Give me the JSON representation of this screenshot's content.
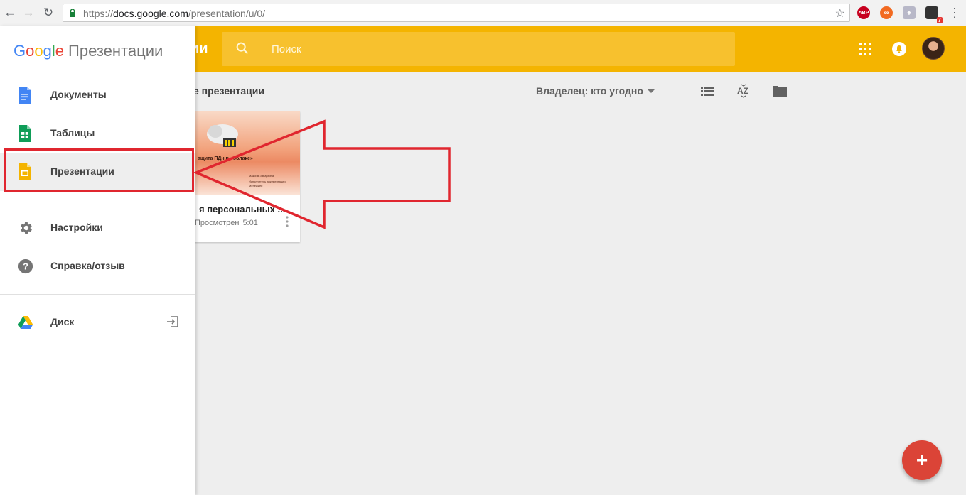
{
  "browser": {
    "url_prefix": "https://",
    "url_host": "docs.google.com",
    "url_path": "/presentation/u/0/",
    "extensions": [
      {
        "icon": "adblock-icon",
        "label": "ABP",
        "color": "#c7001f"
      },
      {
        "icon": "infinity-extension-icon",
        "color": "#f26a21"
      },
      {
        "icon": "bookmark-extension-icon",
        "color": "#a8a8b8"
      },
      {
        "icon": "notification-extension-icon",
        "badge": "7",
        "color": "#333333"
      }
    ]
  },
  "header": {
    "title_partial": "ии",
    "search_placeholder": "Поиск",
    "accent": "#f4b400"
  },
  "drawer": {
    "brand_letters": [
      "G",
      "o",
      "o",
      "g",
      "l",
      "e"
    ],
    "product_name": "Презентации",
    "items": [
      {
        "label": "Документы",
        "icon": "docs-icon",
        "color": "#4285f4"
      },
      {
        "label": "Таблицы",
        "icon": "sheets-icon",
        "color": "#0f9d58"
      },
      {
        "label": "Презентации",
        "icon": "slides-icon",
        "color": "#f4b400",
        "active": true
      },
      {
        "label": "Настройки",
        "icon": "gear-icon"
      },
      {
        "label": "Справка/отзыв",
        "icon": "help-icon"
      },
      {
        "label": "Диск",
        "icon": "drive-icon"
      }
    ]
  },
  "main": {
    "section_title": "е презентации",
    "owner_filter": "Владелец: кто угодно",
    "files": [
      {
        "title": "я персональных ...",
        "meta_label": "Просмотрен",
        "meta_time": "5:01",
        "thumb_title": "ащита ПДн в «облаке»",
        "thumb_lines": [
          "Максим Заварзина",
          "Исполнитель документации",
          "Менеджер"
        ]
      }
    ]
  },
  "fab": {
    "label": "+",
    "color": "#db4437"
  },
  "annotation": {
    "color": "#e0262f"
  }
}
